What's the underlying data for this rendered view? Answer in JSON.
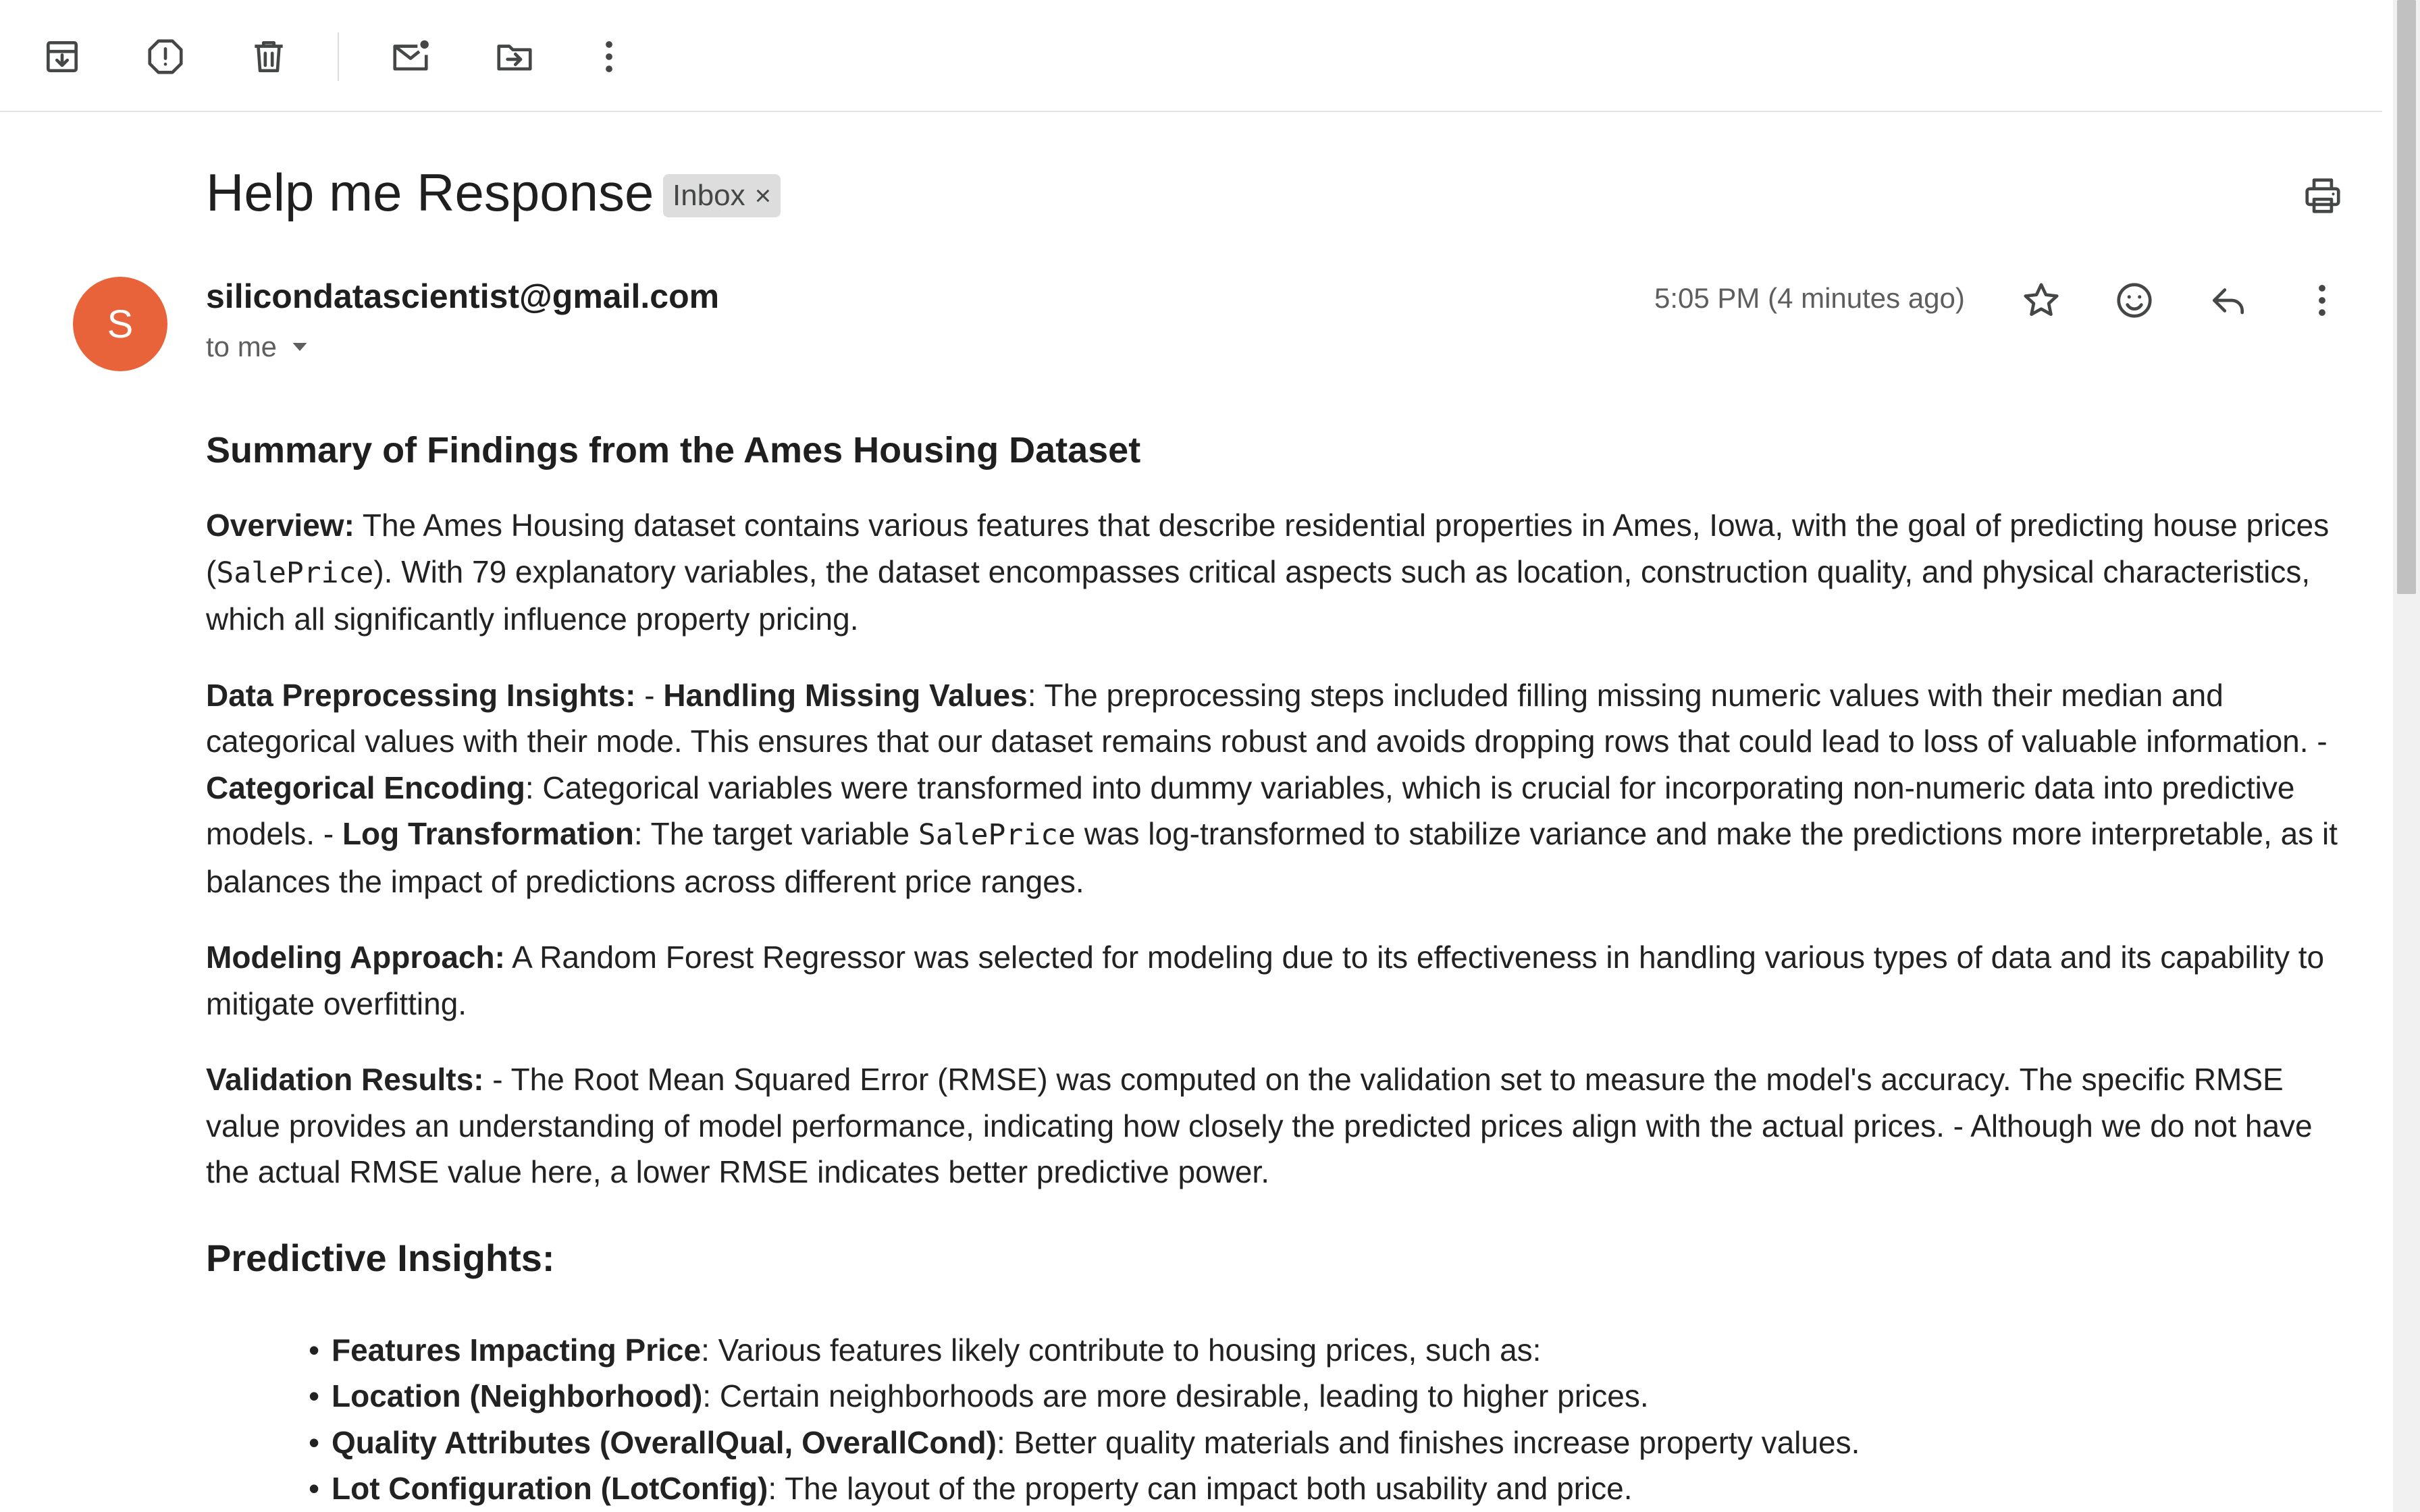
{
  "toolbar": {
    "icons": [
      "archive-icon",
      "report-spam-icon",
      "delete-icon",
      "mark-unread-icon",
      "move-to-icon",
      "more-vert-icon"
    ]
  },
  "email": {
    "subject": "Help me Response",
    "label": "Inbox",
    "label_remove": "×",
    "sender_initial": "S",
    "sender": "silicondatascientist@gmail.com",
    "recipient": "to me",
    "timestamp": "5:05 PM (4 minutes ago)"
  },
  "content": {
    "title": "Summary of Findings from the Ames Housing Dataset",
    "overview": {
      "label": "Overview:",
      "text_1": " The Ames Housing dataset contains various features that describe residential properties in Ames, Iowa, with the goal of predicting house prices (",
      "code": "SalePrice",
      "text_2": "). With 79 explanatory variables, the dataset encompasses critical aspects such as location, construction quality, and physical characteristics, which all significantly influence property pricing."
    },
    "preprocessing": {
      "label": "Data Preprocessing Insights:",
      "sep_1": " - ",
      "missing_label": "Handling Missing Values",
      "missing_text": ": The preprocessing steps included filling missing numeric values with their median and categorical values with their mode. This ensures that our dataset remains robust and avoids dropping rows that could lead to loss of valuable information. - ",
      "encoding_label": "Categorical Encoding",
      "encoding_text": ": Categorical variables were transformed into dummy variables, which is crucial for incorporating non-numeric data into predictive models. - ",
      "log_label": "Log Transformation",
      "log_text_1": ": The target variable ",
      "log_code": "SalePrice",
      "log_text_2": " was log-transformed to stabilize variance and make the predictions more interpretable, as it balances the impact of predictions across different price ranges."
    },
    "modeling": {
      "label": "Modeling Approach:",
      "text": " A Random Forest Regressor was selected for modeling due to its effectiveness in handling various types of data and its capability to mitigate overfitting."
    },
    "validation": {
      "label": "Validation Results:",
      "text": " - The Root Mean Squared Error (RMSE) was computed on the validation set to measure the model's accuracy. The specific RMSE value provides an understanding of model performance, indicating how closely the predicted prices align with the actual prices. - Although we do not have the actual RMSE value here, a lower RMSE indicates better predictive power."
    },
    "predictive_heading": "Predictive Insights:",
    "bullets": [
      {
        "label": "Features Impacting Price",
        "text": ": Various features likely contribute to housing prices, such as:"
      },
      {
        "label": "Location (Neighborhood)",
        "text": ": Certain neighborhoods are more desirable, leading to higher prices."
      },
      {
        "label": "Quality Attributes (OverallQual, OverallCond)",
        "text": ": Better quality materials and finishes increase property values."
      },
      {
        "label": "Lot Configuration (LotConfig)",
        "text": ": The layout of the property can impact both usability and price."
      }
    ]
  },
  "colors": {
    "avatar": "#e8633a",
    "chip": "#dddddd",
    "divider": "#e3e3e3"
  }
}
